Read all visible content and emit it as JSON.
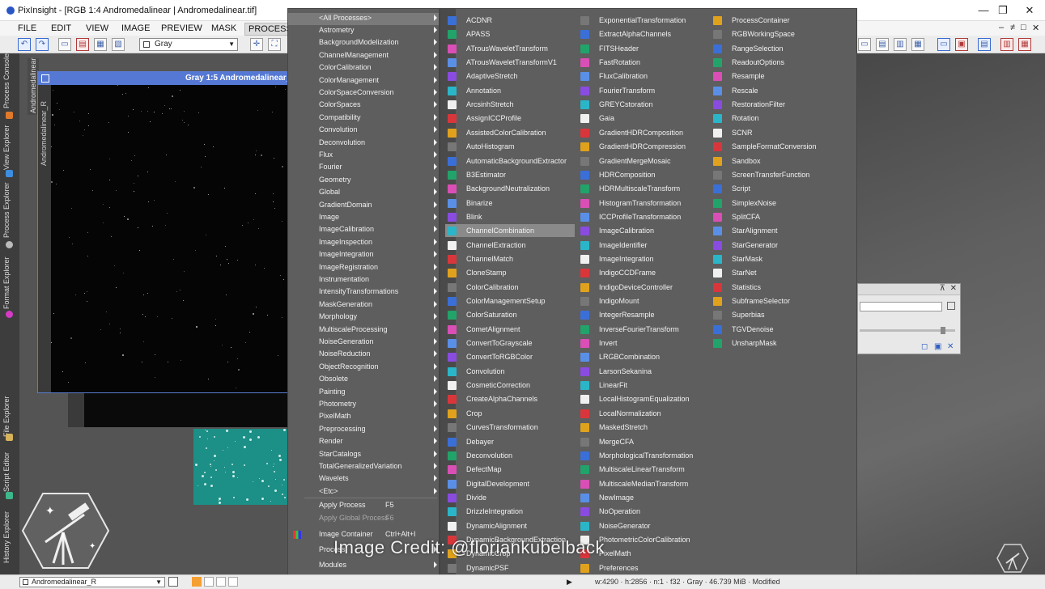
{
  "window": {
    "title": "PixInsight - [RGB 1:4 Andromedalinear | Andromedalinear.tif]",
    "minimize": "—",
    "restore": "❐",
    "close": "✕"
  },
  "menubar": {
    "items": [
      "FILE",
      "EDIT",
      "VIEW",
      "IMAGE",
      "PREVIEW",
      "MASK",
      "PROCESS"
    ],
    "active": "PROCESS",
    "right_controls": [
      "‒",
      "≠",
      "□",
      "✕"
    ]
  },
  "toolbar": {
    "mask_mode": "Gray"
  },
  "dock": {
    "tabs": [
      "Process Console",
      "Andromedalinear",
      "View Explorer",
      "Process Explorer",
      "Format Explorer",
      "File Explorer",
      "Script Editor",
      "History Explorer"
    ]
  },
  "image_window": {
    "title": "Gray 1:5 Andromedalinear_R",
    "side_label": "Andromedalinear_R"
  },
  "process_menu": {
    "header": "<All Processes>",
    "categories": [
      "Astrometry",
      "BackgroundModelization",
      "ChannelManagement",
      "ColorCalibration",
      "ColorManagement",
      "ColorSpaceConversion",
      "ColorSpaces",
      "Compatibility",
      "Convolution",
      "Deconvolution",
      "Flux",
      "Fourier",
      "Geometry",
      "Global",
      "GradientDomain",
      "Image",
      "ImageCalibration",
      "ImageInspection",
      "ImageIntegration",
      "ImageRegistration",
      "Instrumentation",
      "IntensityTransformations",
      "MaskGeneration",
      "Morphology",
      "MultiscaleProcessing",
      "NoiseGeneration",
      "NoiseReduction",
      "ObjectRecognition",
      "Obsolete",
      "Painting",
      "Photometry",
      "PixelMath",
      "Preprocessing",
      "Render",
      "StarCatalogs",
      "TotalGeneralizedVariation",
      "Wavelets",
      "<Etc>"
    ],
    "actions": [
      {
        "label": "Apply Process",
        "shortcut": "F5",
        "enabled": true
      },
      {
        "label": "Apply Global Process",
        "shortcut": "F6",
        "enabled": false
      },
      {
        "label": "Image Container",
        "shortcut": "Ctrl+Alt+I",
        "enabled": true
      },
      {
        "label": "Process",
        "shortcut": "",
        "enabled": true
      },
      {
        "label": "Modules",
        "shortcut": "",
        "enabled": true
      }
    ]
  },
  "all_processes": {
    "highlighted": "ChannelCombination",
    "columns": [
      [
        "ACDNR",
        "APASS",
        "ATrousWaveletTransform",
        "ATrousWaveletTransformV1",
        "AdaptiveStretch",
        "Annotation",
        "ArcsinhStretch",
        "AssignICCProfile",
        "AssistedColorCalibration",
        "AutoHistogram",
        "AutomaticBackgroundExtractor",
        "B3Estimator",
        "BackgroundNeutralization",
        "Binarize",
        "Blink",
        "ChannelCombination",
        "ChannelExtraction",
        "ChannelMatch",
        "CloneStamp",
        "ColorCalibration",
        "ColorManagementSetup",
        "ColorSaturation",
        "CometAlignment",
        "ConvertToGrayscale",
        "ConvertToRGBColor",
        "Convolution",
        "CosmeticCorrection",
        "CreateAlphaChannels",
        "Crop",
        "CurvesTransformation",
        "Debayer",
        "Deconvolution",
        "DefectMap",
        "DigitalDevelopment",
        "Divide",
        "DrizzleIntegration",
        "DynamicAlignment",
        "DynamicBackgroundExtraction",
        "DynamicCrop",
        "DynamicPSF"
      ],
      [
        "ExponentialTransformation",
        "ExtractAlphaChannels",
        "FITSHeader",
        "FastRotation",
        "FluxCalibration",
        "FourierTransform",
        "GREYCstoration",
        "Gaia",
        "GradientHDRComposition",
        "GradientHDRCompression",
        "GradientMergeMosaic",
        "HDRComposition",
        "HDRMultiscaleTransform",
        "HistogramTransformation",
        "ICCProfileTransformation",
        "ImageCalibration",
        "ImageIdentifier",
        "ImageIntegration",
        "IndigoCCDFrame",
        "IndigoDeviceController",
        "IndigoMount",
        "IntegerResample",
        "InverseFourierTransform",
        "Invert",
        "LRGBCombination",
        "LarsonSekanina",
        "LinearFit",
        "LocalHistogramEqualization",
        "LocalNormalization",
        "MaskedStretch",
        "MergeCFA",
        "MorphologicalTransformation",
        "MultiscaleLinearTransform",
        "MultiscaleMedianTransform",
        "NewImage",
        "NoOperation",
        "NoiseGenerator",
        "PhotometricColorCalibration",
        "PixelMath",
        "Preferences"
      ],
      [
        "ProcessContainer",
        "RGBWorkingSpace",
        "RangeSelection",
        "ReadoutOptions",
        "Resample",
        "Rescale",
        "RestorationFilter",
        "Rotation",
        "SCNR",
        "SampleFormatConversion",
        "Sandbox",
        "ScreenTransferFunction",
        "Script",
        "SimplexNoise",
        "SplitCFA",
        "StarAlignment",
        "StarGenerator",
        "StarMask",
        "StarNet",
        "Statistics",
        "SubframeSelector",
        "Superbias",
        "TGVDenoise",
        "UnsharpMask"
      ]
    ]
  },
  "statusbar": {
    "view": "Andromedalinear_R",
    "info": "w:4290 · h:2856 · n:1 · f32 · Gray · 46.739 MiB · Modified"
  },
  "watermark": {
    "credit": "Image Credit: @floriankubelback"
  }
}
